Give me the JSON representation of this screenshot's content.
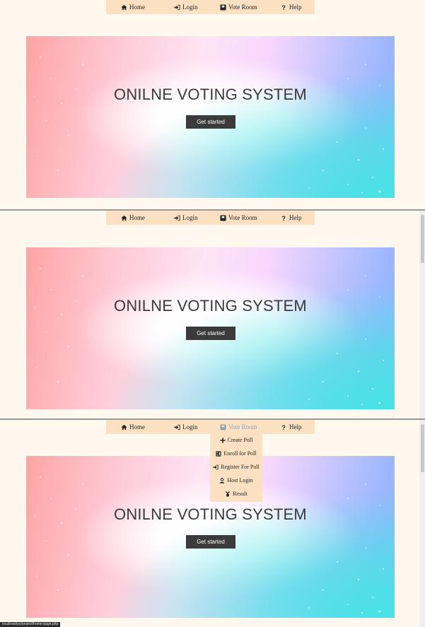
{
  "nav": {
    "home": "Home",
    "login": "Login",
    "vote_room": "Vote Room",
    "help": "Help"
  },
  "hero": {
    "title": "ONILNE VOTING SYSTEM",
    "button": "Get started"
  },
  "dropdown": {
    "items": [
      {
        "label": "Create Poll",
        "icon": "plus-icon"
      },
      {
        "label": "Enroll for Poll",
        "icon": "ballot-icon"
      },
      {
        "label": "Register For Poll",
        "icon": "sign-in-icon"
      },
      {
        "label": "Host Login",
        "icon": "user-icon"
      },
      {
        "label": "Result",
        "icon": "medal-icon"
      }
    ]
  },
  "status_bar": {
    "url": "localhost/yo/project/home-page.php"
  },
  "colors": {
    "nav_bg": "#fbe0c1",
    "page_bg": "#fff8ee",
    "button_bg": "#3b3b3b",
    "hover_text": "#8aa3b5"
  }
}
